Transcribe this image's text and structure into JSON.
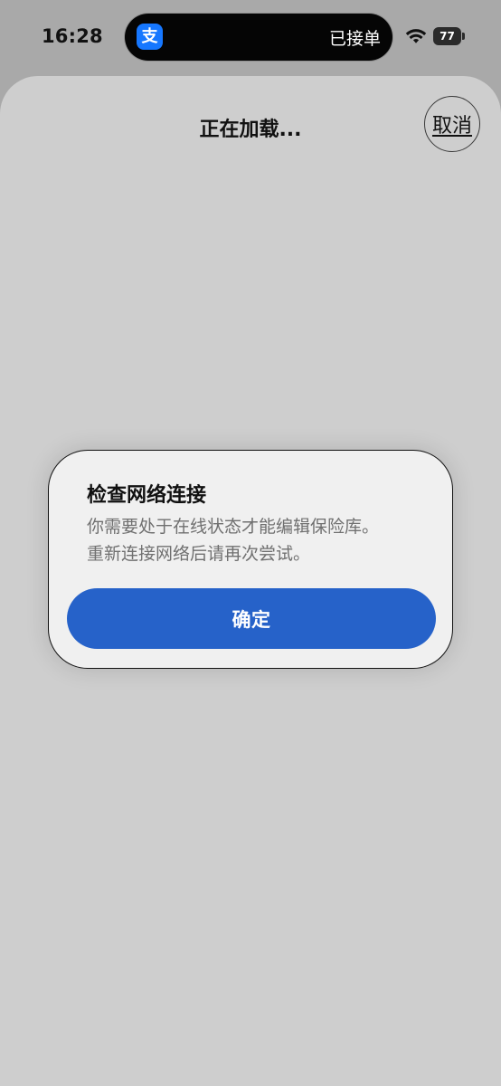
{
  "status_bar": {
    "time": "16:28",
    "island_app_icon": "alipay-icon",
    "island_app_glyph": "支",
    "island_status": "已接单",
    "battery_level": "77",
    "icons": [
      "wifi-icon",
      "battery-icon"
    ]
  },
  "sheet": {
    "title": "正在加载...",
    "cancel_label": "取消"
  },
  "dialog": {
    "title": "检查网络连接",
    "message_line_1": "你需要处于在线状态才能编辑保险库。",
    "message_line_2": "重新连接网络后请再次尝试。",
    "confirm_label": "确定",
    "colors": {
      "confirm_button": "#2662c9",
      "dialog_background": "#f0f0f0",
      "sheet_background": "#cecece",
      "backdrop": "#a9a9a9"
    }
  }
}
